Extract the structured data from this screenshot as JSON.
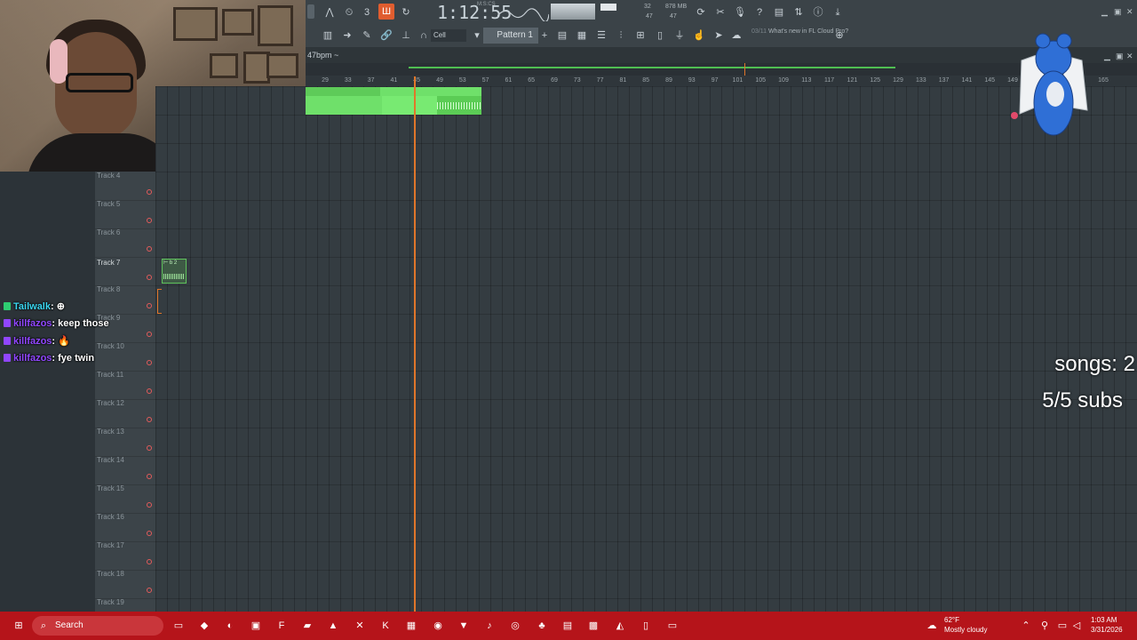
{
  "fl": {
    "time": "1:12:55",
    "time_sub": "M:S:CS",
    "cpu": "32",
    "cpu_b": "47",
    "memory": "878 MB",
    "memory_b": "47",
    "snap": "Cell",
    "pattern": "Pattern 1",
    "news_date": "03/11",
    "news_text": "What's new in FL Cloud Pro?",
    "bpm": "47bpm ~"
  },
  "ruler": [
    "29",
    "33",
    "37",
    "41",
    "45",
    "49",
    "53",
    "57",
    "61",
    "65",
    "69",
    "73",
    "77",
    "81",
    "85",
    "89",
    "93",
    "97",
    "101",
    "105",
    "109",
    "113",
    "117",
    "121",
    "125",
    "129",
    "133",
    "137",
    "141",
    "145",
    "149",
    "165"
  ],
  "tracks": [
    "Track 4",
    "Track 5",
    "Track 6",
    "Track 7",
    "Track 8",
    "Track 9",
    "Track 10",
    "Track 11",
    "Track 12",
    "Track 13",
    "Track 14",
    "Track 15",
    "Track 16",
    "Track 17",
    "Track 18",
    "Track 19"
  ],
  "clip_small_label": "⊢ b 2",
  "chat": [
    {
      "user": "Tailwalk",
      "msg": ": ⊕",
      "color": "#3ad6f0"
    },
    {
      "user": "killfazos",
      "msg": ": keep those",
      "color": "#9147ff"
    },
    {
      "user": "killfazos",
      "msg": ": 🔥",
      "color": "#9147ff"
    },
    {
      "user": "killfazos",
      "msg": ": fye twin",
      "color": "#9147ff"
    }
  ],
  "overlay": {
    "songs": "songs: 2",
    "subs": "5/5 subs"
  },
  "taskbar": {
    "search": "Search",
    "weather_temp": "62°F",
    "weather_desc": "Mostly cloudy",
    "time": "1:03 AM",
    "date": "3/31/2026"
  },
  "colors": {
    "taskbar": "#b5141a",
    "clip": "#6fe06a",
    "playhead": "#e0762a"
  }
}
